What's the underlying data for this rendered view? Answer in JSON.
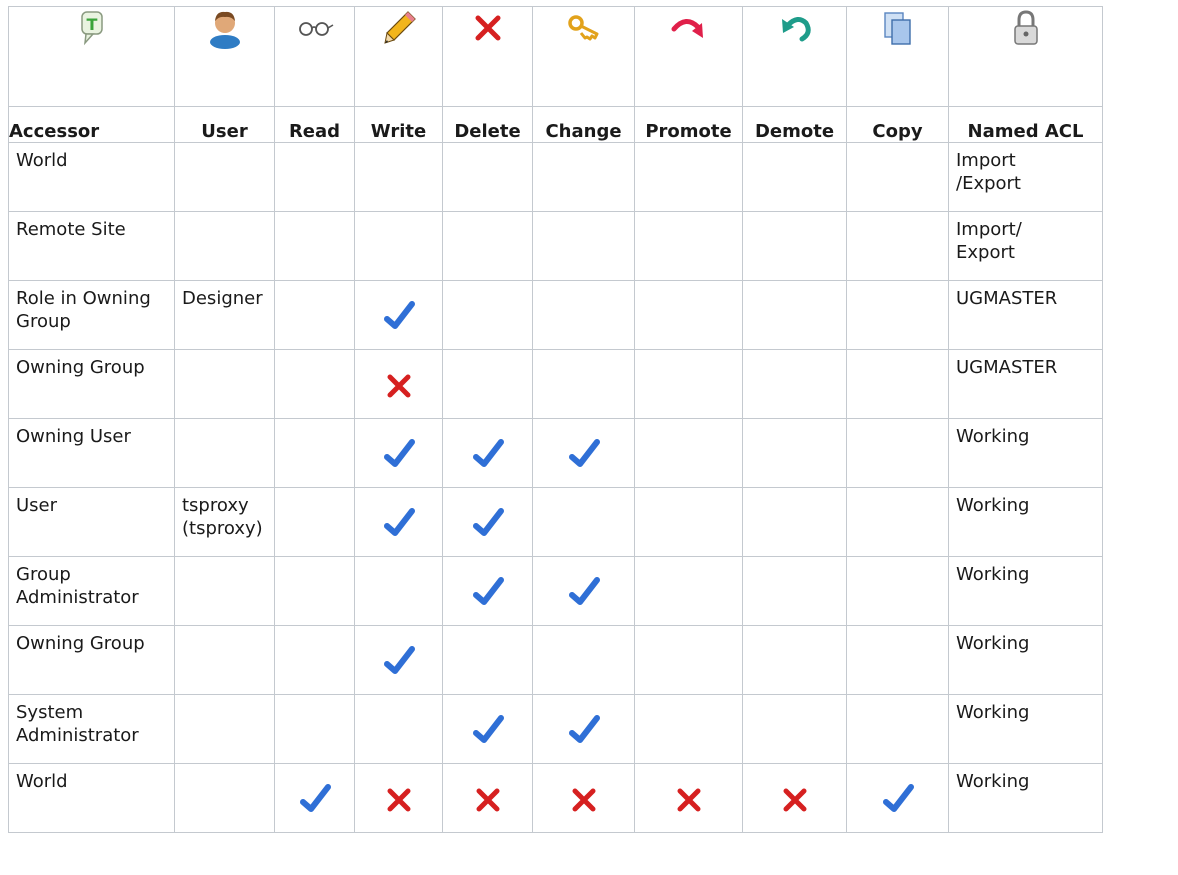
{
  "columns": [
    {
      "label": "Accessor",
      "icon": "text-bubble-icon"
    },
    {
      "label": "User",
      "icon": "user-icon"
    },
    {
      "label": "Read",
      "icon": "glasses-icon"
    },
    {
      "label": "Write",
      "icon": "pencil-icon"
    },
    {
      "label": "Delete",
      "icon": "delete-x-icon"
    },
    {
      "label": "Change",
      "icon": "key-icon"
    },
    {
      "label": "Promote",
      "icon": "promote-arrow-icon"
    },
    {
      "label": "Demote",
      "icon": "demote-arrow-icon"
    },
    {
      "label": "Copy",
      "icon": "copy-icon"
    },
    {
      "label": "Named ACL",
      "icon": "lock-icon"
    }
  ],
  "rows": [
    {
      "accessor": "World",
      "user": "",
      "perms": [
        "",
        "",
        "",
        "",
        "",
        "",
        ""
      ],
      "acl": "Import\n/Export"
    },
    {
      "accessor": "Remote Site",
      "user": "",
      "perms": [
        "",
        "",
        "",
        "",
        "",
        "",
        ""
      ],
      "acl": "Import/\nExport"
    },
    {
      "accessor": "Role in Owning\nGroup",
      "user": "Designer",
      "perms": [
        "",
        "check",
        "",
        "",
        "",
        "",
        ""
      ],
      "acl": "UGMASTER"
    },
    {
      "accessor": "Owning Group",
      "user": "",
      "perms": [
        "",
        "cross",
        "",
        "",
        "",
        "",
        ""
      ],
      "acl": "UGMASTER"
    },
    {
      "accessor": "Owning User",
      "user": "",
      "perms": [
        "",
        "check",
        "check",
        "check",
        "",
        "",
        ""
      ],
      "acl": "Working"
    },
    {
      "accessor": "User",
      "user": "tsproxy\n(tsproxy)",
      "perms": [
        "",
        "check",
        "check",
        "",
        "",
        "",
        ""
      ],
      "acl": "Working"
    },
    {
      "accessor": "Group\nAdministrator",
      "user": "",
      "perms": [
        "",
        "",
        "check",
        "check",
        "",
        "",
        ""
      ],
      "acl": "Working"
    },
    {
      "accessor": "Owning Group",
      "user": "",
      "perms": [
        "",
        "check",
        "",
        "",
        "",
        "",
        ""
      ],
      "acl": "Working"
    },
    {
      "accessor": "System\nAdministrator",
      "user": "",
      "perms": [
        "",
        "",
        "check",
        "check",
        "",
        "",
        ""
      ],
      "acl": "Working"
    },
    {
      "accessor": "World",
      "user": "",
      "perms": [
        "check",
        "cross",
        "cross",
        "cross",
        "cross",
        "cross",
        "check"
      ],
      "acl": "Working"
    }
  ],
  "colors": {
    "check": "#2f6fd6",
    "cross": "#d62020",
    "grid": "#c4c9cf"
  }
}
